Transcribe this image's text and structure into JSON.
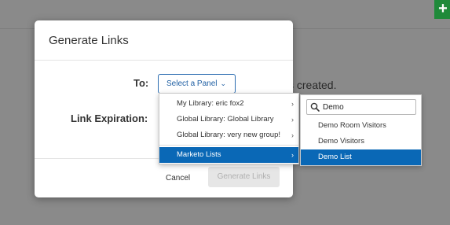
{
  "background": {
    "status_text": "ks created.",
    "add_button_label": "+"
  },
  "modal": {
    "title": "Generate Links",
    "to_label": "To:",
    "expiration_label": "Link Expiration:",
    "select_placeholder": "Select a Panel",
    "cancel_label": "Cancel",
    "generate_label": "Generate Links"
  },
  "panel_menu": {
    "items": [
      {
        "label": "My Library: eric fox2"
      },
      {
        "label": "Global Library: Global Library"
      },
      {
        "label": "Global Library: very new group!"
      },
      {
        "label": "Marketo Lists"
      }
    ],
    "active_index": 3
  },
  "list_submenu": {
    "search_value": "Demo",
    "items": [
      {
        "label": "Demo Room Visitors"
      },
      {
        "label": "Demo Visitors"
      },
      {
        "label": "Demo List"
      }
    ],
    "active_index": 2
  },
  "colors": {
    "accent": "#0a68b6",
    "overlay": "#8a8a8a",
    "add_button": "#1f8a3a"
  }
}
